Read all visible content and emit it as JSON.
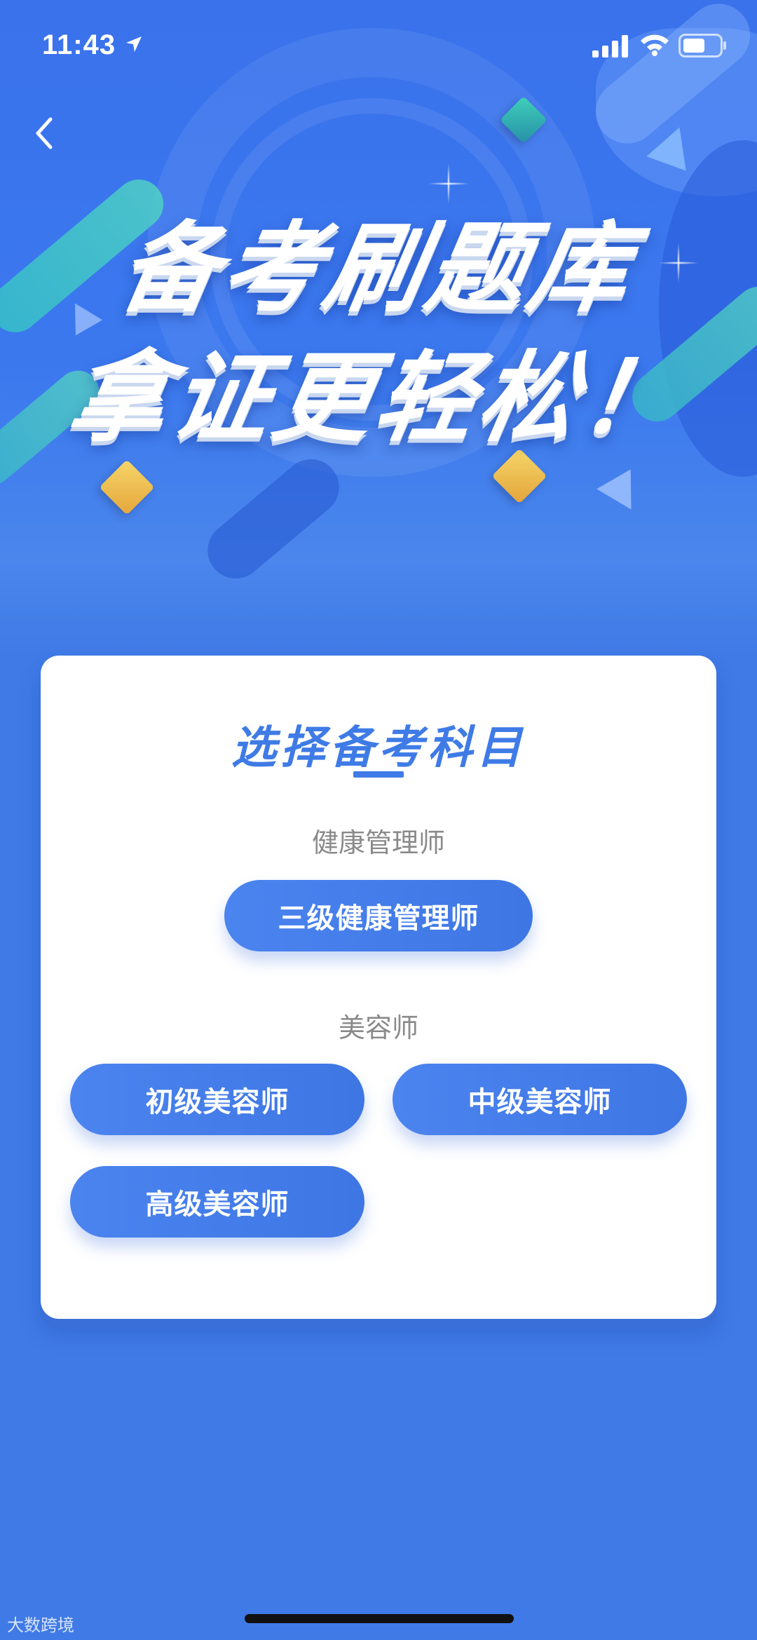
{
  "status_bar": {
    "time": "11:43"
  },
  "hero": {
    "headline_line1": "备考刷题库",
    "headline_line2": "拿证更轻松！"
  },
  "card": {
    "title": "选择备考科目",
    "sections": [
      {
        "label": "健康管理师",
        "buttons": [
          "三级健康管理师"
        ]
      },
      {
        "label": "美容师",
        "buttons": [
          "初级美容师",
          "中级美容师",
          "高级美容师"
        ]
      }
    ]
  },
  "watermark": "大数跨境",
  "colors": {
    "primary": "#3f7be6",
    "background": "#3f7ae6",
    "card": "#ffffff",
    "label_gray": "#8a8a8a",
    "accent_gold": "#f0c050",
    "accent_teal": "#3fc8c0"
  },
  "icons": [
    "location-arrow-icon",
    "signal-icon",
    "wifi-icon",
    "battery-icon",
    "back-chevron-icon"
  ]
}
